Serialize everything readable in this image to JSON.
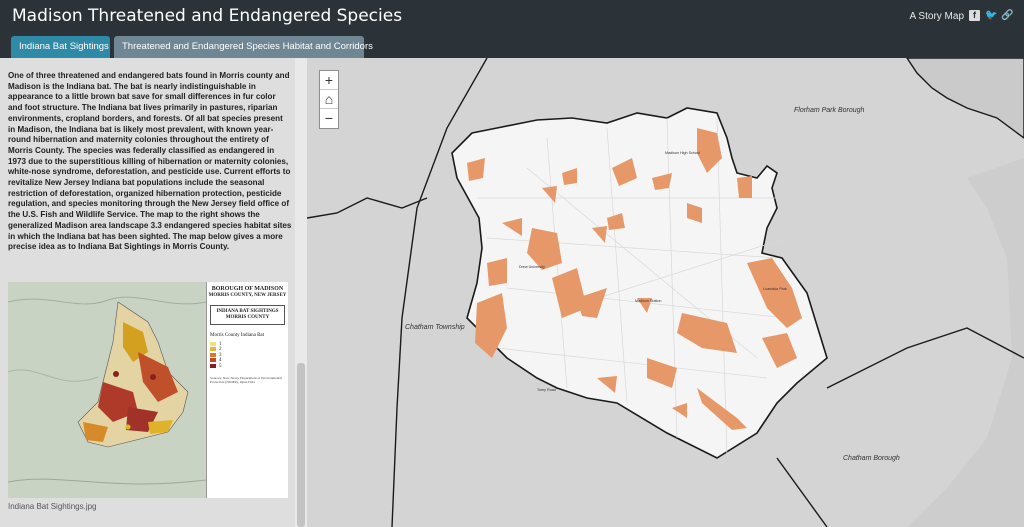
{
  "header": {
    "title": "Madison Threatened and Endangered Species",
    "story_map_label": "A Story Map"
  },
  "tabs": [
    {
      "label": "Indiana Bat Sightings",
      "active": true
    },
    {
      "label": "Threatened and Endangered Species Habitat and Corridors",
      "active": false
    }
  ],
  "side": {
    "text": "One of three threatened and endangered bats found in Morris county and Madison is the Indiana bat. The bat is nearly indistinguishable in appearance to a little brown bat save for small differences in fur color and foot structure. The Indiana bat lives primarily in pastures, riparian environments, cropland borders, and forests. Of all bat species present in Madison, the Indiana bat is likely most prevalent, with known year-round hibernation and maternity colonies throughout the entirety of Morris County. The species was federally classified as endangered in 1973 due to the superstitious killing of hibernation or maternity colonies, white-nose syndrome, deforestation, and pesticide use. Current efforts to revitalize New Jersey Indiana bat populations include the seasonal restriction of deforestation, organized hibernation protection, pesticide regulation, and species monitoring through the New Jersey field office of the U.S. Fish and Wildlife Service. The map to the right shows the generalized Madison area landscape 3.3 endangered species habitat sites in which the Indiana bat has been sighted. The map below gives a more precise idea as to Indiana Bat Sightings in Morris County.",
    "image_caption": "Indiana Bat Sightings.jpg"
  },
  "figure": {
    "borough_title": "BOROUGH OF MADISON",
    "borough_sub": "MORRIS COUNTY, NEW JERSEY",
    "box_title_1": "INDIANA BAT SIGHTINGS",
    "box_title_2": "MORRIS COUNTY",
    "legend_title": "Morris County Indiana Bat",
    "legend_items": [
      "1",
      "2",
      "3",
      "4",
      "5"
    ],
    "notes": "Sources: New Jersey Department of Environmental Protection (NJDEP), Open Data"
  },
  "zoom": {
    "in": "+",
    "home": "⌂",
    "out": "−"
  },
  "map": {
    "labels": {
      "florham_park": "Florham Park Borough",
      "chatham_township": "Chatham Township",
      "chatham_borough": "Chatham Borough"
    },
    "places": {
      "madison_high": "Madison High School",
      "drew": "Drew University",
      "madison_station": "Madison Station",
      "loantaka": "Loantaka Park",
      "torey": "Torey Road"
    }
  },
  "colors": {
    "habitat": "#e69868",
    "map_background": "#d4d4d4",
    "header": "#2b3338",
    "tab_active": "#2e8aa6",
    "tab_inactive": "#6f8694"
  }
}
